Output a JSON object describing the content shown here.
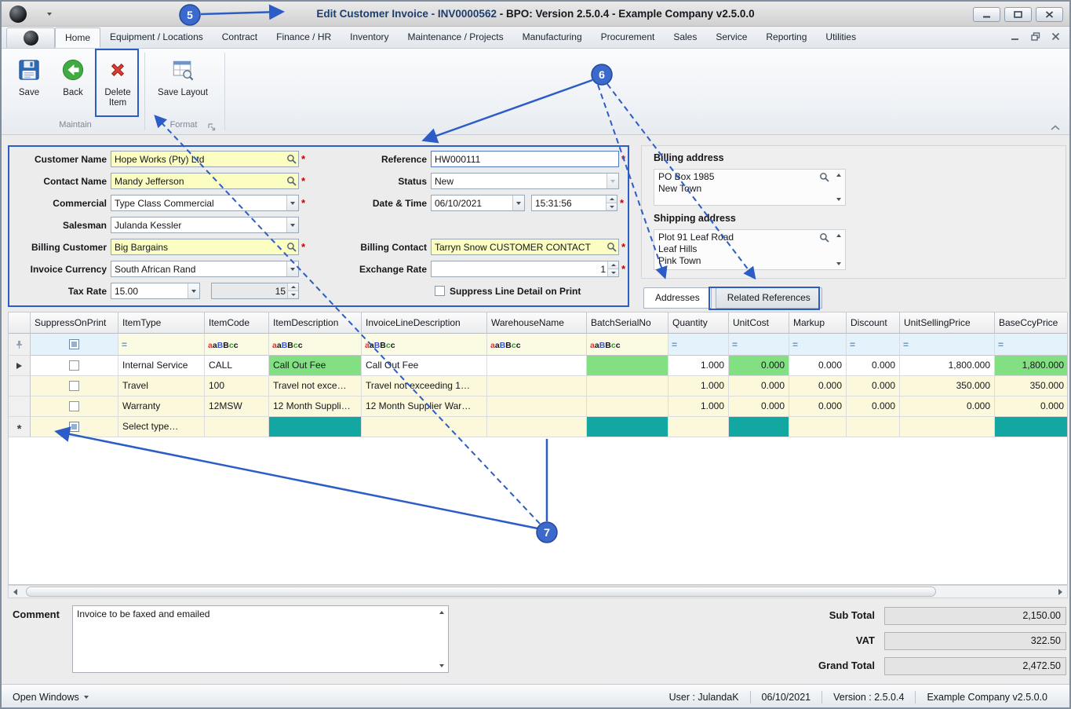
{
  "titlebar": {
    "title_primary": "Edit Customer Invoice - INV0000562",
    "title_secondary": " - BPO: Version 2.5.0.4 - Example Company v2.5.0.0"
  },
  "ribbon": {
    "tabs": [
      "Home",
      "Equipment / Locations",
      "Contract",
      "Finance / HR",
      "Inventory",
      "Maintenance / Projects",
      "Manufacturing",
      "Procurement",
      "Sales",
      "Service",
      "Reporting",
      "Utilities"
    ],
    "buttons": {
      "save": "Save",
      "back": "Back",
      "delete_item": "Delete Item",
      "save_layout": "Save Lay­out"
    },
    "groups": {
      "maintain": "Maintain",
      "format": "Format"
    }
  },
  "form": {
    "required_marker": "*",
    "customer_name": {
      "label": "Customer Name",
      "value": "Hope Works (Pty) Ltd"
    },
    "contact_name": {
      "label": "Contact Name",
      "value": "Mandy Jefferson"
    },
    "commercial": {
      "label": "Commercial",
      "value": "Type Class Commercial"
    },
    "salesman": {
      "label": "Salesman",
      "value": "Julanda Kessler"
    },
    "billing_customer": {
      "label": "Billing Customer",
      "value": "Big Bargains"
    },
    "invoice_currency": {
      "label": "Invoice Currency",
      "value": "South African Rand"
    },
    "tax_rate": {
      "label": "Tax Rate",
      "rate": "15.00",
      "amount": "15"
    },
    "reference": {
      "label": "Reference",
      "value": "HW000111"
    },
    "status": {
      "label": "Status",
      "value": "New"
    },
    "date_time": {
      "label": "Date & Time",
      "date": "06/10/2021",
      "time": "15:31:56"
    },
    "billing_contact": {
      "label": "Billing Contact",
      "value": "Tarryn Snow CUSTOMER CONTACT"
    },
    "exchange_rate": {
      "label": "Exchange Rate",
      "value": "1"
    },
    "suppress_line_detail": {
      "label": "Suppress Line Detail on Print"
    }
  },
  "addresses": {
    "billing_label": "Billing address",
    "billing": {
      "line1": "PO Box 1985",
      "line2": "New Town"
    },
    "shipping_label": "Shipping address",
    "shipping": {
      "line1": "Plot 91 Leaf Road",
      "line2": "Leaf Hills",
      "line3": "Pink Town"
    }
  },
  "section_tabs": {
    "addresses": "Addresses",
    "related_references": "Related References"
  },
  "grid": {
    "columns": [
      "SuppressOnPrint",
      "ItemType",
      "ItemCode",
      "ItemDescription",
      "InvoiceLineDescription",
      "WarehouseName",
      "BatchSerialNo",
      "Quantity",
      "UnitCost",
      "Markup",
      "Discount",
      "UnitSellingPrice",
      "BaseCcyPrice"
    ],
    "rows": [
      {
        "item_type": "Internal Service",
        "item_code": "CALL",
        "item_description": "Call Out Fee",
        "invoice_line_description": "Call Out Fee",
        "warehouse_name": "",
        "batch_serial_no": "",
        "quantity": "1.000",
        "unit_cost": "0.000",
        "markup": "0.000",
        "discount": "0.000",
        "unit_selling_price": "1,800.000",
        "base_ccy_price": "1,800.000"
      },
      {
        "item_type": "Travel",
        "item_code": "100",
        "item_description": "Travel not exce…",
        "invoice_line_description": "Travel not exceeding 1…",
        "warehouse_name": "",
        "batch_serial_no": "",
        "quantity": "1.000",
        "unit_cost": "0.000",
        "markup": "0.000",
        "discount": "0.000",
        "unit_selling_price": "350.000",
        "base_ccy_price": "350.000"
      },
      {
        "item_type": "Warranty",
        "item_code": "12MSW",
        "item_description": "12 Month Suppli…",
        "invoice_line_description": "12 Month Supplier War…",
        "warehouse_name": "",
        "batch_serial_no": "",
        "quantity": "1.000",
        "unit_cost": "0.000",
        "markup": "0.000",
        "discount": "0.000",
        "unit_selling_price": "0.000",
        "base_ccy_price": "0.000"
      }
    ],
    "new_row_prompt": "Select type…"
  },
  "icons": {
    "abc_a": "a",
    "abc_b": "B",
    "abc_c": "c"
  },
  "footer": {
    "comment_label": "Comment",
    "comment_text": "Invoice to be faxed and emailed",
    "totals": [
      {
        "label": "Sub Total",
        "value": "2,150.00"
      },
      {
        "label": "VAT",
        "value": "322.50"
      },
      {
        "label": "Grand Total",
        "value": "2,472.50"
      }
    ]
  },
  "statusbar": {
    "open_windows": "Open Windows",
    "user": "User : JulandaK",
    "date": "06/10/2021",
    "version": "Version : 2.5.0.4",
    "company": "Example Company v2.5.0.0"
  },
  "annotations": {
    "callout_5": "5",
    "callout_6": "6",
    "callout_7": "7"
  }
}
